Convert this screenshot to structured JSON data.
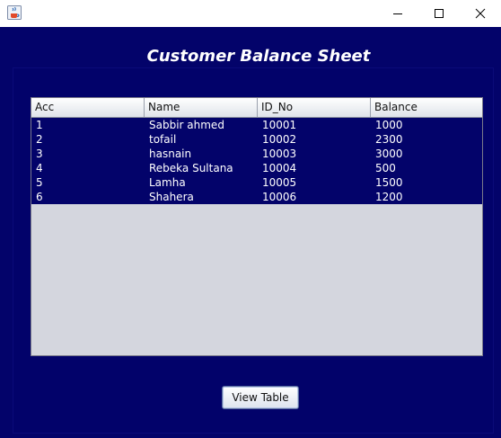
{
  "window": {
    "controls": {
      "minimize_icon": "minimize-icon",
      "maximize_icon": "maximize-icon",
      "close_icon": "close-icon"
    },
    "app_icon": "java-cup-icon"
  },
  "heading": "Customer Balance Sheet",
  "table": {
    "columns": [
      "Acc",
      "Name",
      "ID_No",
      "Balance"
    ],
    "rows": [
      [
        "1",
        "Sabbir ahmed",
        "10001",
        "1000"
      ],
      [
        "2",
        "tofail",
        "10002",
        "2300"
      ],
      [
        "3",
        "hasnain",
        "10003",
        "3000"
      ],
      [
        "4",
        "Rebeka Sultana",
        "10004",
        "500"
      ],
      [
        "5",
        "Lamha",
        "10005",
        "1500"
      ],
      [
        "6",
        "Shahera",
        "10006",
        "1200"
      ]
    ]
  },
  "view_button_label": "View Table",
  "colors": {
    "background": "#03036a",
    "table_empty": "#d4d6de"
  }
}
